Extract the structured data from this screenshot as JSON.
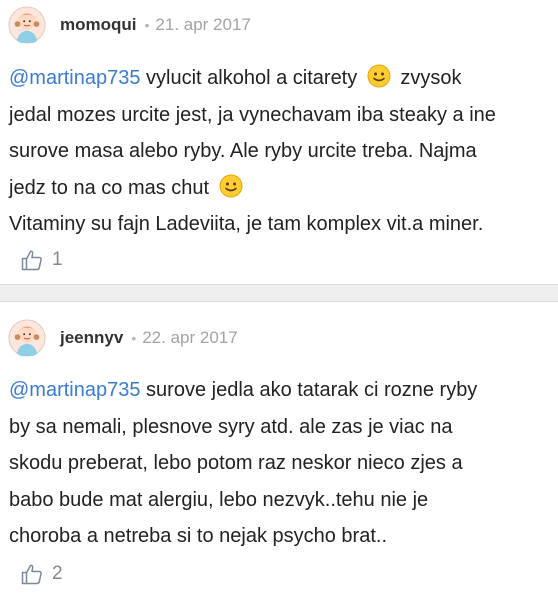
{
  "comments": [
    {
      "username": "momoqui",
      "separator": "•",
      "date": "21. apr 2017",
      "lines": [
        {
          "mention": "@martinap735",
          "text": " vylucit alkohol a citarety ",
          "emoji": "slightly-smiling-face",
          "after": " zvysok"
        },
        {
          "text": "jedal mozes urcite jest, ja vynechavam iba steaky a ine"
        },
        {
          "text": "surove masa alebo ryby. Ale ryby urcite treba. Najma"
        },
        {
          "text": "jedz to na co mas chut ",
          "emoji": "slightly-smiling-face"
        },
        {
          "text": "Vitaminy su fajn Ladeviita, je tam komplex vit.a miner."
        }
      ],
      "likes": "1",
      "like_icon": "thumbs-up-icon"
    },
    {
      "username": "jeennyv",
      "separator": "•",
      "date": "22. apr 2017",
      "lines": [
        {
          "mention": "@martinap735",
          "text": " surove jedla ako tatarak ci rozne ryby"
        },
        {
          "text": "by sa nemali, plesnove syry atd. ale zas je viac na"
        },
        {
          "text": "skodu preberat, lebo potom raz neskor nieco zjes a"
        },
        {
          "text": "babo bude mat alergiu, lebo nezvyk..tehu nie je"
        },
        {
          "text": "choroba a netreba si to nejak psycho brat.."
        }
      ],
      "likes": "2",
      "like_icon": "thumbs-up-icon"
    }
  ],
  "colors": {
    "mention": "#3a7bd5",
    "separator_bg": "#efefef",
    "emoji_face": "#ffcc33"
  }
}
